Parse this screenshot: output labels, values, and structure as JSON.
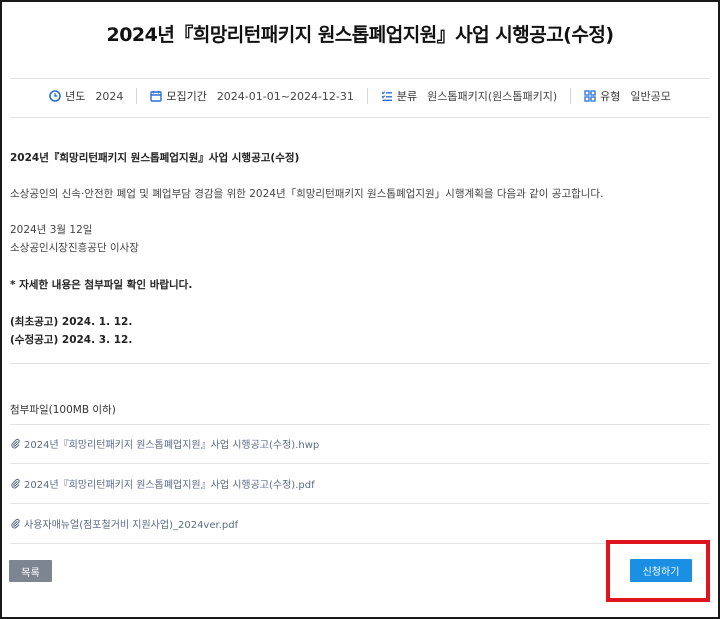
{
  "title": "2024년『희망리턴패키지 원스톱폐업지원』사업 시행공고(수정)",
  "meta": [
    {
      "icon": "clock-icon",
      "label": "년도",
      "value": "2024"
    },
    {
      "icon": "calendar-icon",
      "label": "모집기간",
      "value": "2024-01-01~2024-12-31"
    },
    {
      "icon": "list-icon",
      "label": "분류",
      "value": "원스톱패키지(원스톱패키지)"
    },
    {
      "icon": "grid-icon",
      "label": "유형",
      "value": "일반공모"
    }
  ],
  "body": {
    "heading": "2024년『희망리턴패키지 원스톱폐업지원』사업 시행공고(수정)",
    "intro": "소상공인의 신속·안전한 폐업 및 폐업부담 경감을 위한 2024년「희망리턴패키지 원스톱폐업지원」시행계획을 다음과 같이 공고합니다.",
    "date": "2024년 3월 12일",
    "issuer": "소상공인시장진흥공단 이사장",
    "notice": "* 자세한 내용은 첨부파일 확인 바랍니다.",
    "first_notice": "(최초공고) 2024. 1. 12.",
    "revised_notice": "(수정공고) 2024. 3. 12."
  },
  "attachments": {
    "title": "첨부파일(100MB 이하)",
    "files": [
      "2024년『희망리턴패키지 원스톱폐업지원』사업 시행공고(수정).hwp",
      "2024년『희망리턴패키지 원스톱폐업지원』사업 시행공고(수정).pdf",
      "사용자매뉴얼(점포철거비 지원사업)_2024ver.pdf"
    ]
  },
  "buttons": {
    "list_label": "목록",
    "apply_label": "신청하기"
  },
  "colors": {
    "apply_button": "#1a8fe3",
    "list_button": "#7d8590",
    "highlight_box": "#e0141e",
    "file_link": "#5b6b88"
  }
}
